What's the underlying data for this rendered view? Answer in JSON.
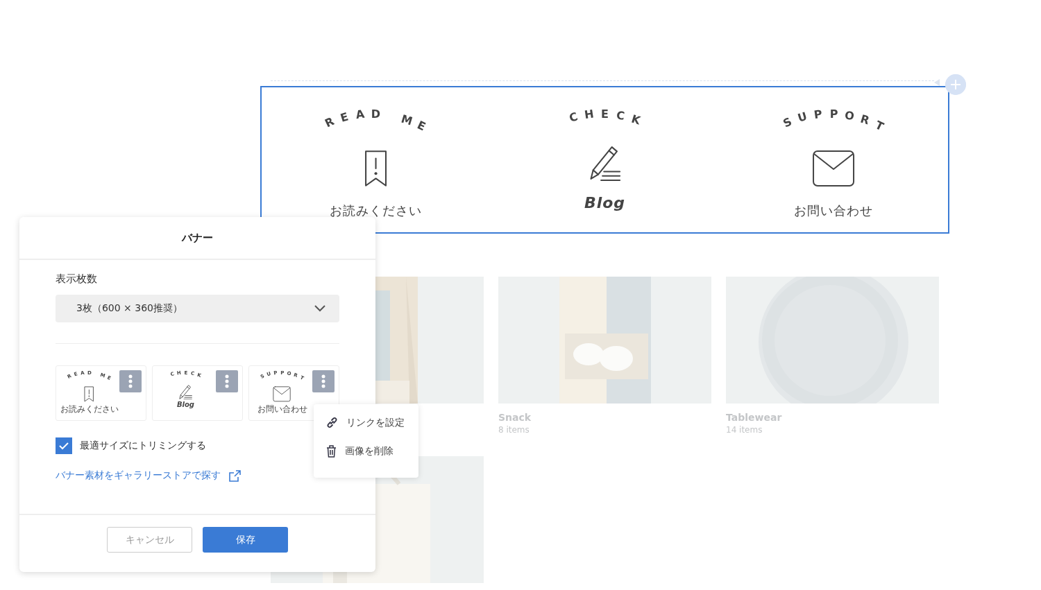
{
  "banner": {
    "items": [
      {
        "arc_text": "READ ME",
        "caption": "お読みください",
        "kind": "bookmark"
      },
      {
        "arc_text": "CHECK",
        "caption": "Blog",
        "kind": "pencil"
      },
      {
        "arc_text": "SUPPORT",
        "caption": "お問い合わせ",
        "kind": "envelope"
      }
    ]
  },
  "products": [
    {
      "kind": "picture"
    },
    {
      "kind": "picture",
      "name": "Snack",
      "count": "8 items"
    },
    {
      "kind": "picture",
      "name": "Tablewear",
      "count": "14 items"
    },
    {
      "kind": "picture"
    }
  ],
  "dialog": {
    "title": "バナー",
    "field_label": "表示枚数",
    "select_value": "3枚（600 × 360推奨）",
    "thumbnails": [
      {
        "arc_text": "READ ME",
        "caption": "お読みください",
        "kind": "bookmark"
      },
      {
        "arc_text": "CHECK",
        "caption": "Blog",
        "kind": "pencil"
      },
      {
        "arc_text": "SUPPORT",
        "caption": "お問い合わせ",
        "kind": "envelope"
      }
    ],
    "trim": {
      "label": "最適サイズにトリミングする",
      "checked": true
    },
    "link": "バナー素材をギャラリーストアで探す",
    "buttons": [
      {
        "label": "キャンセル",
        "kind": "secondary"
      },
      {
        "label": "保存",
        "kind": "primary"
      }
    ]
  },
  "context_menu": {
    "items": [
      {
        "label": "リンクを設定",
        "kind": "link"
      },
      {
        "label": "画像を削除",
        "kind": "trash"
      }
    ]
  }
}
